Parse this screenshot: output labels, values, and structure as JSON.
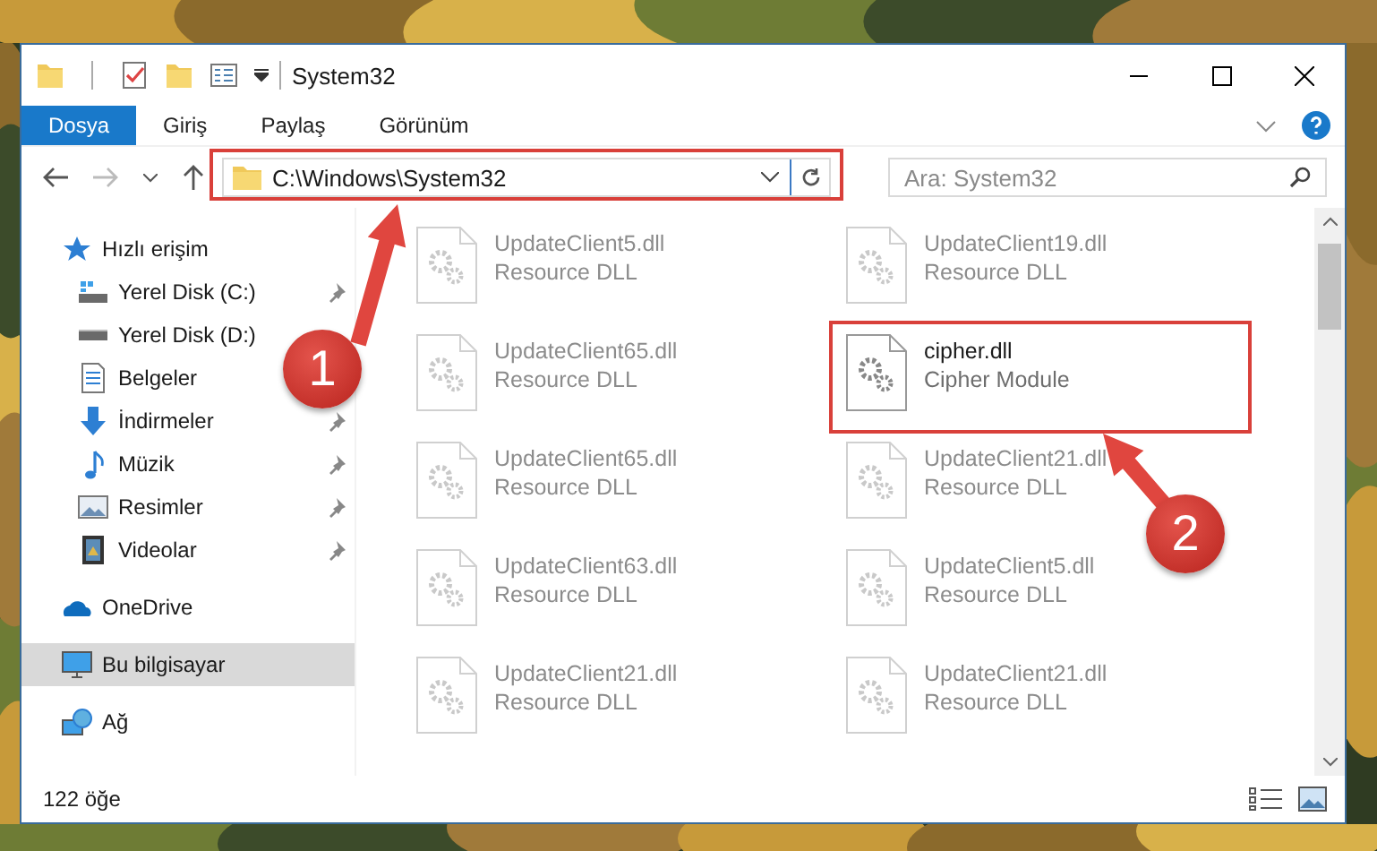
{
  "window": {
    "title": "System32"
  },
  "quick_toolbar": [
    {
      "kind": "folder"
    },
    {
      "kind": "check"
    },
    {
      "kind": "folder"
    },
    {
      "kind": "props"
    }
  ],
  "ribbon_tabs": [
    {
      "label": "Dosya",
      "selected": true
    },
    {
      "label": "Giriş",
      "selected": false
    },
    {
      "label": "Paylaş",
      "selected": false
    },
    {
      "label": "Görünüm",
      "selected": false
    }
  ],
  "address": {
    "path": "C:\\Windows\\System32"
  },
  "search": {
    "placeholder": "Ara: System32"
  },
  "sidebar": {
    "items": [
      {
        "label": "Hızlı erişim",
        "kind": "star",
        "selected": false,
        "pinned": false,
        "children": [
          {
            "label": "Yerel Disk (C:)",
            "kind": "drive-c",
            "selected": false,
            "pinned": true
          },
          {
            "label": "Yerel Disk (D:)",
            "kind": "drive",
            "selected": false,
            "pinned": false
          },
          {
            "label": "Belgeler",
            "kind": "docs",
            "selected": false,
            "pinned": false
          },
          {
            "label": "İndirmeler",
            "kind": "download",
            "selected": false,
            "pinned": true
          },
          {
            "label": "Müzik",
            "kind": "music",
            "selected": false,
            "pinned": true
          },
          {
            "label": "Resimler",
            "kind": "pictures",
            "selected": false,
            "pinned": true
          },
          {
            "label": "Videolar",
            "kind": "videos",
            "selected": false,
            "pinned": true
          }
        ]
      },
      {
        "label": "OneDrive",
        "kind": "cloud",
        "selected": false,
        "pinned": false
      },
      {
        "label": "Bu bilgisayar",
        "kind": "pc",
        "selected": true,
        "pinned": false
      },
      {
        "label": "Ağ",
        "kind": "network",
        "selected": false,
        "pinned": false
      }
    ]
  },
  "files": [
    {
      "name": "UpdateClient5.dll",
      "description": "Resource DLL",
      "blurred": true
    },
    {
      "name": "UpdateClient19.dll",
      "description": "Resource DLL",
      "blurred": true
    },
    {
      "name": "UpdateClient65.dll",
      "description": "Resource DLL",
      "blurred": true
    },
    {
      "name": "cipher.dll",
      "description": "Cipher Module",
      "blurred": false
    },
    {
      "name": "UpdateClient65.dll",
      "description": "Resource DLL",
      "blurred": true
    },
    {
      "name": "UpdateClient21.dll",
      "description": "Resource DLL",
      "blurred": true
    },
    {
      "name": "UpdateClient63.dll",
      "description": "Resource DLL",
      "blurred": true
    },
    {
      "name": "UpdateClient5.dll",
      "description": "Resource DLL",
      "blurred": true
    },
    {
      "name": "UpdateClient21.dll",
      "description": "Resource DLL",
      "blurred": true
    },
    {
      "name": "UpdateClient21.dll",
      "description": "Resource DLL",
      "blurred": true
    }
  ],
  "status_bar": {
    "item_count": "122 öğe"
  },
  "annotations": [
    {
      "label": "1"
    },
    {
      "label": "2"
    }
  ]
}
